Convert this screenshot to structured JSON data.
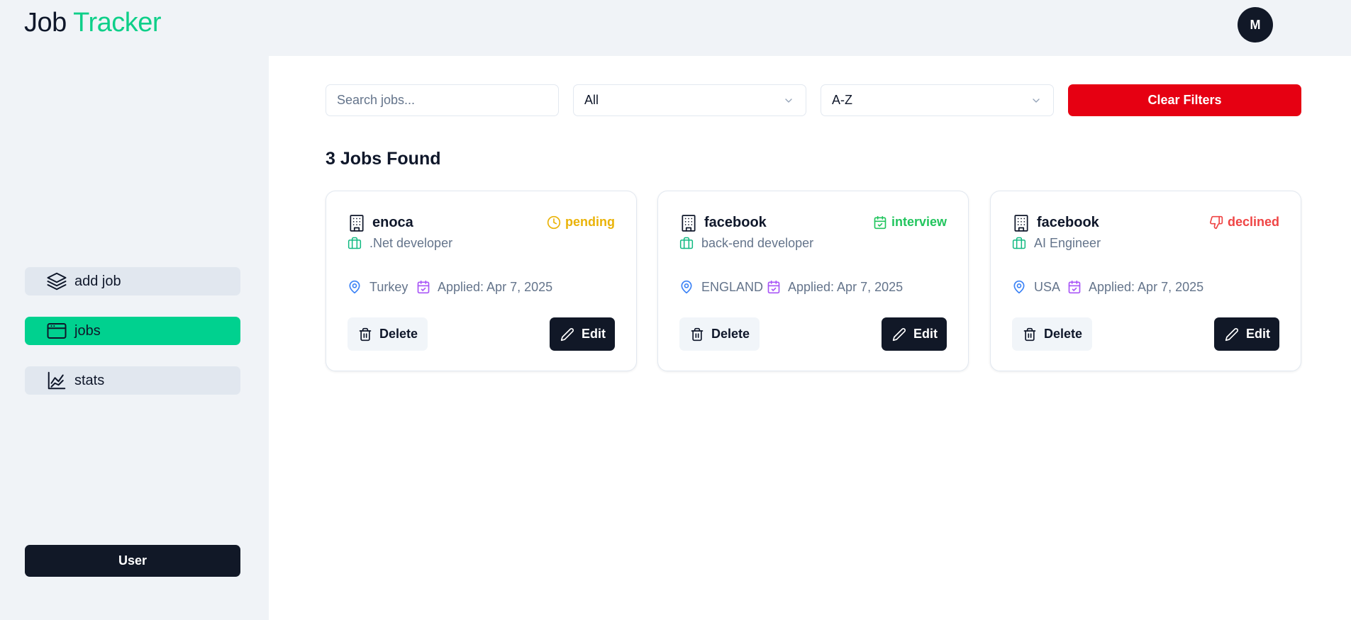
{
  "header": {
    "logo_part1": "Job",
    "logo_part2": "Tracker",
    "avatar_initial": "M"
  },
  "sidebar": {
    "items": [
      {
        "label": "add job",
        "icon": "layers-icon",
        "active": false
      },
      {
        "label": "jobs",
        "icon": "browser-window-icon",
        "active": true
      },
      {
        "label": "stats",
        "icon": "chart-icon",
        "active": false
      }
    ],
    "user_button": "User"
  },
  "filters": {
    "search_placeholder": "Search jobs...",
    "status_value": "All",
    "sort_value": "A-Z",
    "clear_label": "Clear Filters"
  },
  "results": {
    "count_text": "3 Jobs Found"
  },
  "jobs": [
    {
      "company": "enoca",
      "position": ".Net developer",
      "status": "pending",
      "status_icon": "clock-icon",
      "status_color": "#eab308",
      "location": "Turkey",
      "applied": "Applied: Apr 7, 2025",
      "delete_label": "Delete",
      "edit_label": "Edit"
    },
    {
      "company": "facebook",
      "position": "back-end developer",
      "status": "interview",
      "status_icon": "calendar-check-icon",
      "status_color": "#22c55e",
      "location": "ENGLAND",
      "applied": "Applied: Apr 7, 2025",
      "delete_label": "Delete",
      "edit_label": "Edit"
    },
    {
      "company": "facebook",
      "position": "AI Engineer",
      "status": "declined",
      "status_icon": "thumbs-down-icon",
      "status_color": "#ef4444",
      "location": "USA",
      "applied": "Applied: Apr 7, 2025",
      "delete_label": "Delete",
      "edit_label": "Edit"
    }
  ],
  "colors": {
    "accent": "#00d18f",
    "dark": "#111827",
    "danger": "#e60012",
    "location_icon": "#3b82f6",
    "date_icon": "#a855f7",
    "position_icon": "#10b981"
  }
}
